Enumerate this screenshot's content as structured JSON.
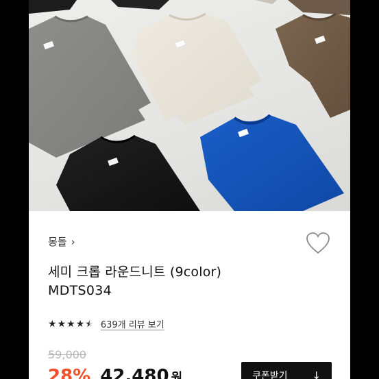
{
  "hero": {
    "label_marks": [
      "",
      "",
      "",
      "",
      "",
      ""
    ]
  },
  "product": {
    "brand": "몽돌",
    "brand_chevron": "›",
    "name": "세미 크롭 라운드니트 (9color)",
    "code": "MDTS034",
    "rating_stars": 4.5,
    "review_link": "639개 리뷰 보기",
    "original_price": "59,000",
    "discount": "28%",
    "sale_price": "42,480",
    "currency": "원"
  },
  "coupon": {
    "label": "쿠폰받기",
    "icon": "↓"
  },
  "colors": {
    "discount": "#f0502a",
    "button": "#111111",
    "heart": "#8a8a8a"
  }
}
